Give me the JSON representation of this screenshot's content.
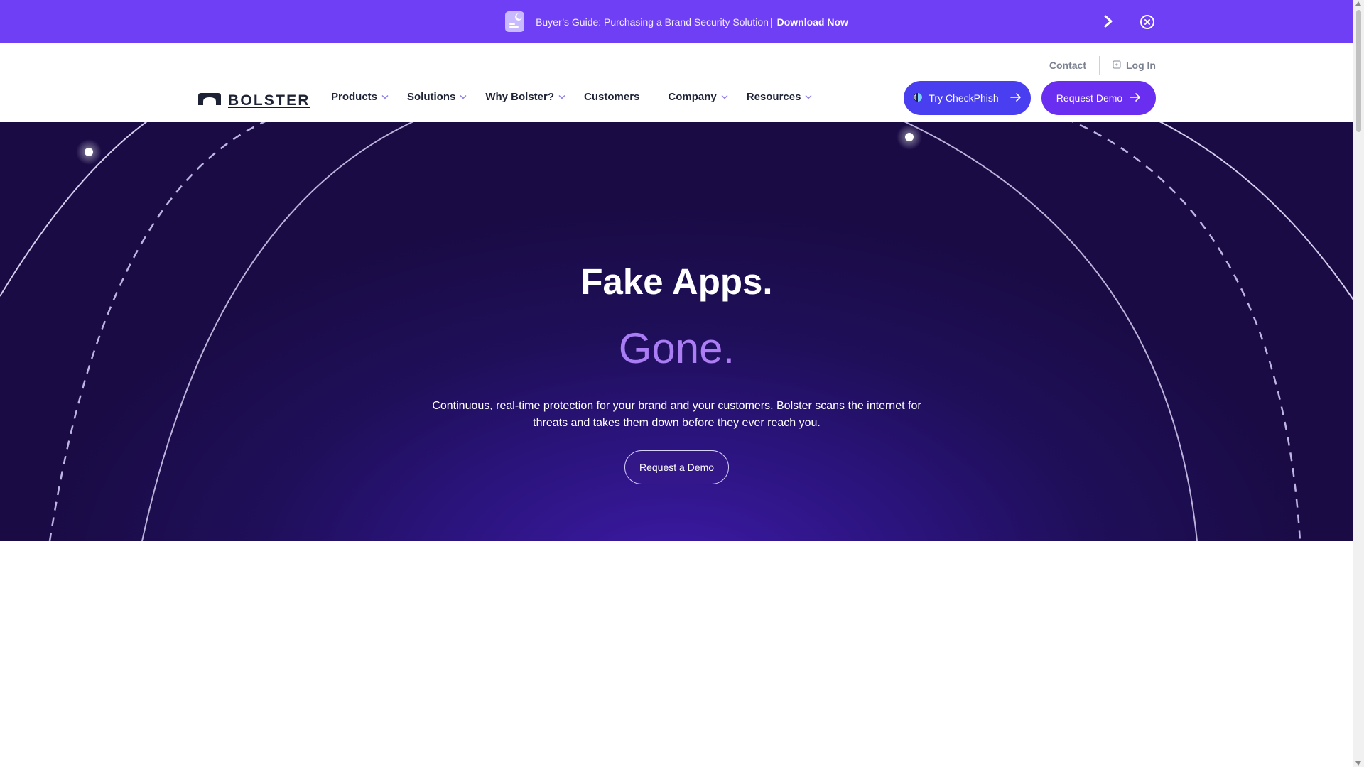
{
  "announcement": {
    "text": "Buyer’s Guide: Purchasing a Brand Security Solution",
    "separator": "|",
    "link_label": "Download Now",
    "icons": {
      "doc": "document-icon",
      "next": "chevron-right-icon",
      "close": "close-circle-icon"
    }
  },
  "utility_nav": {
    "contact_label": "Contact",
    "login_label": "Log In",
    "login_icon": "login-icon"
  },
  "brand": {
    "name": "BOLSTER",
    "logo_icon": "arch-logo-icon"
  },
  "nav": {
    "items": [
      {
        "label": "Products",
        "has_dropdown": true
      },
      {
        "label": "Solutions",
        "has_dropdown": true
      },
      {
        "label": "Why Bolster?",
        "has_dropdown": true
      },
      {
        "label": "Customers",
        "has_dropdown": false
      },
      {
        "label": "Company",
        "has_dropdown": true
      },
      {
        "label": "Resources",
        "has_dropdown": true
      }
    ]
  },
  "cta": {
    "checkphish_label": "Try CheckPhish",
    "request_demo_label": "Request Demo"
  },
  "hero": {
    "title": "Fake Apps.",
    "highlight": "Gone.",
    "description": "Continuous, real-time protection for your brand and your customers. Bolster scans the internet for threats and takes them down before they ever reach you.",
    "button_label": "Request a Demo"
  },
  "colors": {
    "announcement_bg": "#6f3ff5",
    "checkphish_bg": "#4a3ff0",
    "demo_bg": "#6a2ef0",
    "hero_bg": "#1f0f5a",
    "brand_text": "#1d2235"
  }
}
